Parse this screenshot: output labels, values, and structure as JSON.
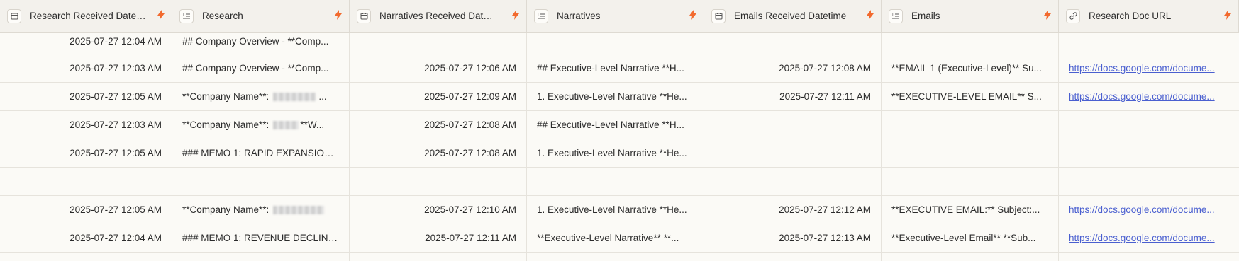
{
  "columns": [
    {
      "label": "Research Received Date…",
      "icon": "calendar-icon"
    },
    {
      "label": "Research",
      "icon": "long-text-icon"
    },
    {
      "label": "Narratives Received Dat…",
      "icon": "calendar-icon"
    },
    {
      "label": "Narratives",
      "icon": "long-text-icon"
    },
    {
      "label": "Emails Received Datetime",
      "icon": "calendar-icon"
    },
    {
      "label": "Emails",
      "icon": "long-text-icon"
    },
    {
      "label": "Research Doc URL",
      "icon": "link-icon"
    }
  ],
  "colors": {
    "bolt": "#f26a2e",
    "link": "#4a5fd0",
    "header_bg": "#f3f1ec",
    "body_bg": "#fbfaf6"
  },
  "rows": [
    {
      "c0": "2025-07-27 12:04 AM",
      "c1": "## Company Overview - **Comp...",
      "c2": "",
      "c3": "",
      "c4": "",
      "c5": "",
      "c6": ""
    },
    {
      "c0": "2025-07-27 12:03 AM",
      "c1": "## Company Overview - **Comp...",
      "c2": "2025-07-27 12:06 AM",
      "c3": "## Executive-Level Narrative **H...",
      "c4": "2025-07-27 12:08 AM",
      "c5": "**EMAIL 1 (Executive-Level)** Su...",
      "c6": "https://docs.google.com/docume..."
    },
    {
      "c0": "2025-07-27 12:05 AM",
      "c1": "**Company Name**:",
      "c1_tail": "...",
      "c2": "2025-07-27 12:09 AM",
      "c3": "1. Executive-Level Narrative **He...",
      "c4": "2025-07-27 12:11 AM",
      "c5": "**EXECUTIVE-LEVEL EMAIL** S...",
      "c6": "https://docs.google.com/docume..."
    },
    {
      "c0": "2025-07-27 12:03 AM",
      "c1": "**Company Name**:",
      "c1_tail": "**W...",
      "c2": "2025-07-27 12:08 AM",
      "c3": "## Executive-Level Narrative **H...",
      "c4": "",
      "c5": "",
      "c6": ""
    },
    {
      "c0": "2025-07-27 12:05 AM",
      "c1": "### MEMO 1: RAPID EXPANSION ...",
      "c2": "2025-07-27 12:08 AM",
      "c3": "1. Executive-Level Narrative **He...",
      "c4": "",
      "c5": "",
      "c6": ""
    },
    {
      "c0": "",
      "c1": "",
      "c2": "",
      "c3": "",
      "c4": "",
      "c5": "",
      "c6": ""
    },
    {
      "c0": "2025-07-27 12:05 AM",
      "c1": "**Company Name**:",
      "c1_tail": "",
      "c2": "2025-07-27 12:10 AM",
      "c3": "1. Executive-Level Narrative **He...",
      "c4": "2025-07-27 12:12 AM",
      "c5": "**EXECUTIVE EMAIL:** Subject:...",
      "c6": "https://docs.google.com/docume..."
    },
    {
      "c0": "2025-07-27 12:04 AM",
      "c1": "### MEMO 1: REVENUE DECLINE ...",
      "c2": "2025-07-27 12:11 AM",
      "c3": "**Executive-Level Narrative** **...",
      "c4": "2025-07-27 12:13 AM",
      "c5": "**Executive-Level Email** **Sub...",
      "c6": "https://docs.google.com/docume..."
    },
    {
      "c0": "",
      "c1": "",
      "c2": "",
      "c3": "",
      "c4": "",
      "c5": "",
      "c6": ""
    }
  ]
}
